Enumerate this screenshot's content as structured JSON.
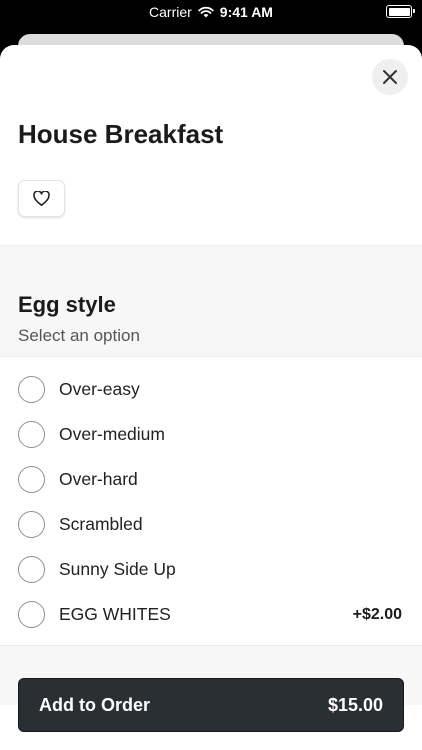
{
  "status_bar": {
    "carrier": "Carrier",
    "time": "9:41 AM"
  },
  "item": {
    "title": "House Breakfast"
  },
  "section": {
    "title": "Egg style",
    "subtitle": "Select an option",
    "options": [
      {
        "label": "Over-easy",
        "price": ""
      },
      {
        "label": "Over-medium",
        "price": ""
      },
      {
        "label": "Over-hard",
        "price": ""
      },
      {
        "label": "Scrambled",
        "price": ""
      },
      {
        "label": "Sunny Side Up",
        "price": ""
      },
      {
        "label": "EGG WHITES",
        "price": "+$2.00"
      }
    ]
  },
  "footer": {
    "add_label": "Add to Order",
    "total": "$15.00"
  },
  "colors": {
    "button_bg": "#2a2f33",
    "section_bg": "#f7f7f7",
    "close_bg": "#efefef"
  }
}
